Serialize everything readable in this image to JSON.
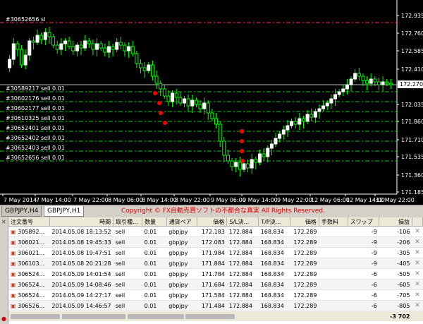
{
  "chart": {
    "price_labels": [
      "172.935",
      "172.760",
      "172.585",
      "172.410",
      "172.035",
      "171.860",
      "171.710",
      "171.535",
      "171.360",
      "171.185"
    ],
    "current_price": "172.270",
    "time_labels": [
      "7 May 2014",
      "7 May 14:00",
      "7 May 22:00",
      "8 May 06:00",
      "8 May 14:00",
      "8 May 22:00",
      "9 May 06:00",
      "9 May 14:00",
      "9 May 22:00",
      "12 May 06:00",
      "12 May 14:00",
      "12 May 22:00"
    ],
    "order_lines": [
      {
        "label": "#30652656 sl",
        "type": "sl"
      },
      {
        "label": "#30589217 sell 0.01"
      },
      {
        "label": "#30602176 sell 0.01"
      },
      {
        "label": "#30602177 sell 0.01"
      },
      {
        "label": "#30610325 sell 0.01"
      },
      {
        "label": "#30652401 sell 0.01"
      },
      {
        "label": "#30652402 sell 0.01"
      },
      {
        "label": "#30652403 sell 0.01"
      },
      {
        "label": "#30652656 sell 0.01"
      }
    ],
    "colors": {
      "bull": "#ffffff",
      "bear": "#00ff00",
      "sl_line": "#ff3030",
      "order_line": "#00cc00",
      "entry_marker": "#ff0000"
    }
  },
  "tabs": {
    "tab1": "GBPJPY,H4",
    "tab2": "GBPJPY,H1"
  },
  "copyright": "Copyright © FX自動売買ソフトの不都合な真実 All Rights Reserved.",
  "table": {
    "headers": {
      "ticket": "注文番号",
      "time": "時間",
      "type": "取引種...",
      "size": "数量",
      "symbol": "通貨ペア",
      "price": "価格",
      "sl": "S/L決...",
      "tp": "T/P決...",
      "cur_price": "価格",
      "commission": "手数料",
      "swap": "スワップ",
      "profit": "損益"
    },
    "rows": [
      {
        "ticket": "305892...",
        "time": "2014.05.08 18:13:52",
        "type": "sell",
        "size": "0.01",
        "symbol": "gbpjpy",
        "price": "172.183",
        "sl": "172.884",
        "tp": "168.834",
        "cur": "172.289",
        "swap": "-9",
        "profit": "-106"
      },
      {
        "ticket": "306021...",
        "time": "2014.05.08 19:45:33",
        "type": "sell",
        "size": "0.01",
        "symbol": "gbpjpy",
        "price": "172.083",
        "sl": "172.884",
        "tp": "168.834",
        "cur": "172.289",
        "swap": "-9",
        "profit": "-206"
      },
      {
        "ticket": "306021...",
        "time": "2014.05.08 19:47:51",
        "type": "sell",
        "size": "0.01",
        "symbol": "gbpjpy",
        "price": "171.984",
        "sl": "172.884",
        "tp": "168.834",
        "cur": "172.289",
        "swap": "-9",
        "profit": "-305"
      },
      {
        "ticket": "306103...",
        "time": "2014.05.08 20:21:28",
        "type": "sell",
        "size": "0.01",
        "symbol": "gbpjpy",
        "price": "171.884",
        "sl": "172.884",
        "tp": "168.834",
        "cur": "172.289",
        "swap": "-9",
        "profit": "-405"
      },
      {
        "ticket": "306524...",
        "time": "2014.05.09 14:01:54",
        "type": "sell",
        "size": "0.01",
        "symbol": "gbpjpy",
        "price": "171.784",
        "sl": "172.884",
        "tp": "168.834",
        "cur": "172.289",
        "swap": "-6",
        "profit": "-505"
      },
      {
        "ticket": "306524...",
        "time": "2014.05.09 14:08:46",
        "type": "sell",
        "size": "0.01",
        "symbol": "gbpjpy",
        "price": "171.684",
        "sl": "172.884",
        "tp": "168.834",
        "cur": "172.289",
        "swap": "-6",
        "profit": "-605"
      },
      {
        "ticket": "306524...",
        "time": "2014.05.09 14:27:17",
        "type": "sell",
        "size": "0.01",
        "symbol": "gbpjpy",
        "price": "171.584",
        "sl": "172.884",
        "tp": "168.834",
        "cur": "172.289",
        "swap": "-6",
        "profit": "-705"
      },
      {
        "ticket": "306526...",
        "time": "2014.05.09 14:46:57",
        "type": "sell",
        "size": "0.01",
        "symbol": "gbpjpy",
        "price": "171.484",
        "sl": "172.884",
        "tp": "168.834",
        "cur": "172.289",
        "swap": "-6",
        "profit": "-805"
      }
    ],
    "total_profit": "-3 702"
  }
}
